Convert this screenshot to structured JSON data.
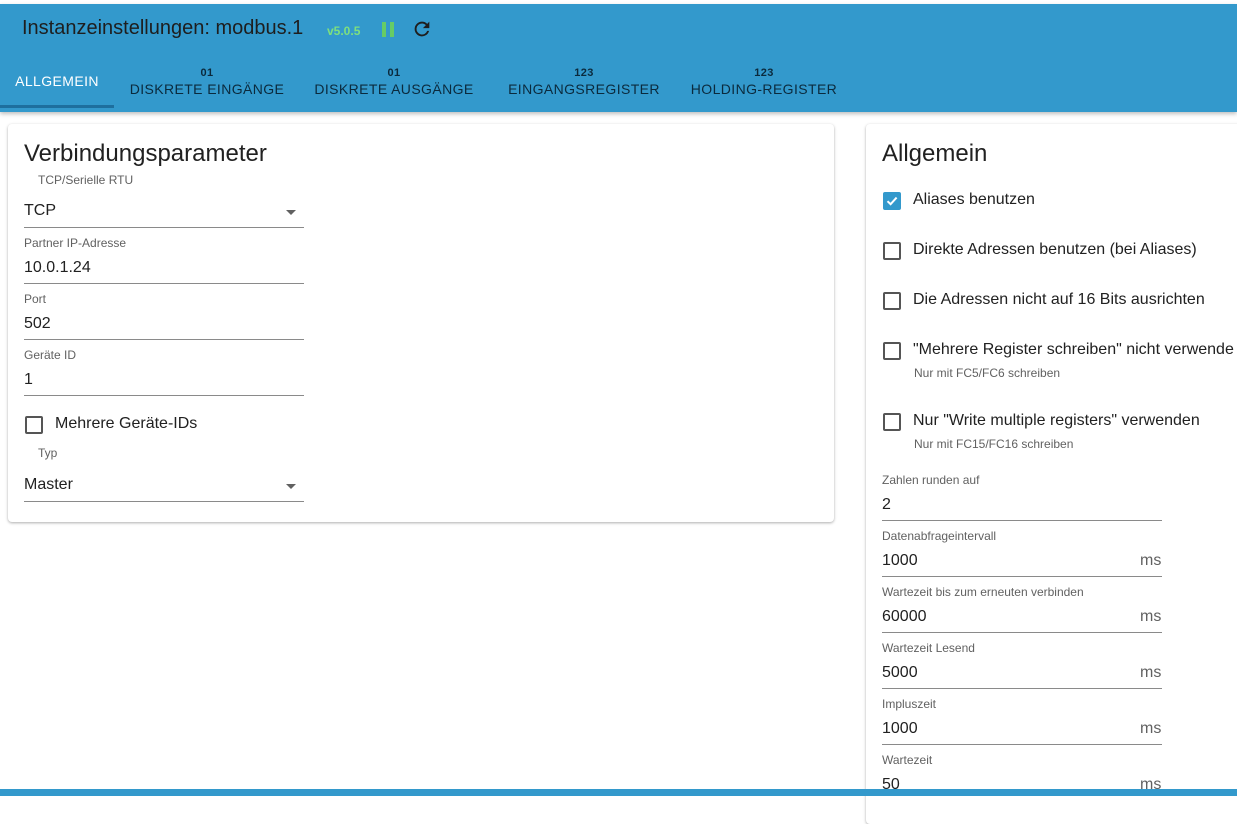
{
  "header": {
    "title": "Instanzeinstellungen: modbus.1",
    "version": "v5.0.5",
    "pause_icon": "pause-icon",
    "refresh_icon": "refresh-icon"
  },
  "tabs": [
    {
      "label": "ALLGEMEIN",
      "icon": "",
      "active": true
    },
    {
      "label": "DISKRETE EINGÄNGE",
      "icon": "01"
    },
    {
      "label": "DISKRETE AUSGÄNGE",
      "icon": "01"
    },
    {
      "label": "EINGANGSREGISTER",
      "icon": "123"
    },
    {
      "label": "HOLDING-REGISTER",
      "icon": "123"
    }
  ],
  "connection": {
    "title": "Verbindungsparameter",
    "mode": {
      "label": "TCP/Serielle RTU",
      "value": "TCP"
    },
    "ip": {
      "label": "Partner IP-Adresse",
      "value": "10.0.1.24"
    },
    "port": {
      "label": "Port",
      "value": "502"
    },
    "device_id": {
      "label": "Geräte ID",
      "value": "1"
    },
    "multi_ids": {
      "label": "Mehrere Geräte-IDs",
      "checked": false
    },
    "type": {
      "label": "Typ",
      "value": "Master"
    }
  },
  "general": {
    "title": "Allgemein",
    "checkboxes": [
      {
        "label": "Aliases benutzen",
        "checked": true,
        "help": ""
      },
      {
        "label": "Direkte Adressen benutzen (bei Aliases)",
        "checked": false,
        "help": ""
      },
      {
        "label": "Die Adressen nicht auf 16 Bits ausrichten",
        "checked": false,
        "help": ""
      },
      {
        "label": "\"Mehrere Register schreiben\" nicht verwende",
        "checked": false,
        "help": "Nur mit FC5/FC6 schreiben"
      },
      {
        "label": "Nur \"Write multiple registers\" verwenden",
        "checked": false,
        "help": "Nur mit FC15/FC16 schreiben"
      }
    ],
    "fields": [
      {
        "label": "Zahlen runden auf",
        "value": "2",
        "unit": ""
      },
      {
        "label": "Datenabfrageintervall",
        "value": "1000",
        "unit": "ms"
      },
      {
        "label": "Wartezeit bis zum erneuten verbinden",
        "value": "60000",
        "unit": "ms"
      },
      {
        "label": "Wartezeit Lesend",
        "value": "5000",
        "unit": "ms"
      },
      {
        "label": "Impluszeit",
        "value": "1000",
        "unit": "ms"
      },
      {
        "label": "Wartezeit",
        "value": "50",
        "unit": "ms"
      }
    ]
  },
  "colors": {
    "primary": "#3399cc",
    "version": "#7ee07e",
    "pause": "#66cc66"
  }
}
